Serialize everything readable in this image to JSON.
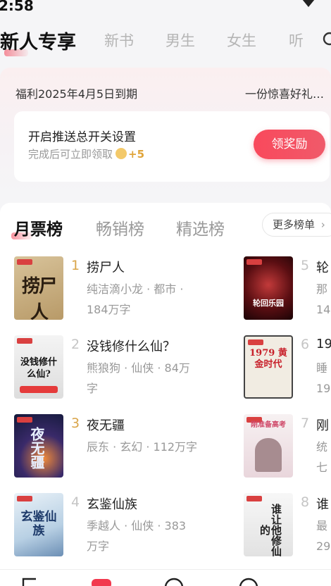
{
  "status_bar": {
    "time": "2:58"
  },
  "top_tabs": [
    "新人专享",
    "新书",
    "男生",
    "女生",
    "听"
  ],
  "welfare": {
    "expiry": "福利2025年4月5日到期",
    "gift": "一份惊喜好礼…",
    "push": {
      "title": "开启推送总开关设置",
      "subtitle": "完成后可立即领取",
      "reward": "+5",
      "button": "领奖励"
    }
  },
  "ranking": {
    "tabs": [
      "月票榜",
      "畅销榜",
      "精选榜"
    ],
    "more": "更多榜单",
    "left_books": [
      {
        "rank": "1",
        "title": "捞尸人",
        "meta_line1": "纯洁滴小龙 · 都市 ·",
        "meta_line2": "184万字",
        "cover_text": "捞尸人"
      },
      {
        "rank": "2",
        "title": "没钱修什么仙？",
        "meta_line1": "熊狼狗 · 仙侠 · 84万",
        "meta_line2": "字",
        "cover_text": "没钱修什么仙?"
      },
      {
        "rank": "3",
        "title": "夜无疆",
        "meta_line1": "辰东 · 玄幻 · 112万字",
        "meta_line2": "",
        "cover_text": "夜无疆"
      },
      {
        "rank": "4",
        "title": "玄鉴仙族",
        "meta_line1": "季越人 · 仙侠 · 383",
        "meta_line2": "万字",
        "cover_text": "玄鉴仙族"
      }
    ],
    "right_books": [
      {
        "rank": "5",
        "title": "轮",
        "meta_line1": "那",
        "meta_line2": "14",
        "cover_text": "轮回乐园"
      },
      {
        "rank": "6",
        "title": "19",
        "meta_line1": "睡",
        "meta_line2": "19",
        "cover_text": "1979 黄金时代"
      },
      {
        "rank": "7",
        "title": "刚",
        "meta_line1": "统",
        "meta_line2": "七",
        "cover_text": "刚准备高考"
      },
      {
        "rank": "8",
        "title": "谁",
        "meta_line1": "最",
        "meta_line2": "29",
        "cover_text": "谁让他修仙的"
      }
    ]
  },
  "colors": {
    "accent": "#f2394e",
    "gold_rank": "#d9a54a",
    "muted": "#999999"
  }
}
